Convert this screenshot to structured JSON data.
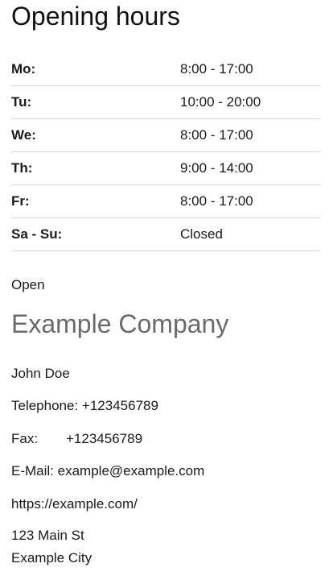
{
  "title": "Opening hours",
  "hours": [
    {
      "day": "Mo:",
      "time": "8:00 - 17:00"
    },
    {
      "day": "Tu:",
      "time": "10:00 - 20:00"
    },
    {
      "day": "We:",
      "time": "8:00 - 17:00"
    },
    {
      "day": "Th:",
      "time": "9:00 - 14:00"
    },
    {
      "day": "Fr:",
      "time": "8:00 - 17:00"
    },
    {
      "day": "Sa - Su:",
      "time": "Closed"
    }
  ],
  "status": "Open",
  "company": {
    "name": "Example Company",
    "contact_person": "John Doe",
    "telephone_label": "Telephone:",
    "telephone": "+123456789",
    "fax_label": "Fax:",
    "fax": "+123456789",
    "email_label": "E-Mail:",
    "email": "example@example.com",
    "website": "https://example.com/",
    "street": "123 Main St",
    "city": "Example City"
  }
}
